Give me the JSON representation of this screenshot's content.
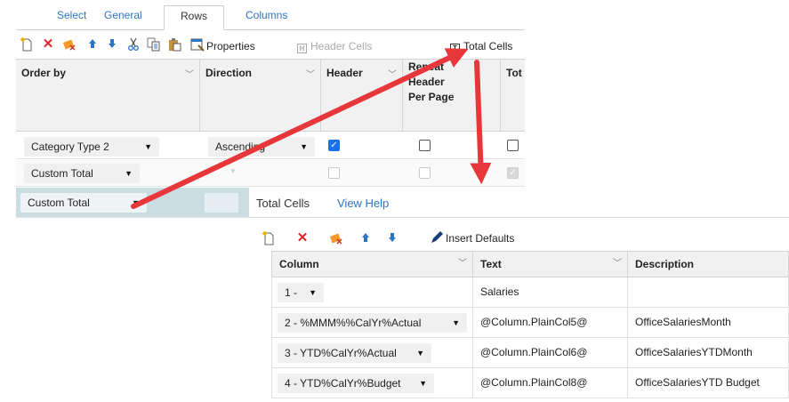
{
  "tabs": [
    {
      "label": "Select"
    },
    {
      "label": "General"
    },
    {
      "label": "Rows"
    },
    {
      "label": "Columns"
    }
  ],
  "toolbar": {
    "properties": "Properties",
    "header_cells": "Header Cells",
    "total_cells": "Total Cells",
    "header_cells_glyph": "H",
    "total_cells_glyph": "T"
  },
  "rows_grid": {
    "columns": [
      "Order by",
      "Direction",
      "Header",
      "Repeat Header Per Page",
      "Tot"
    ],
    "rows": [
      {
        "order_by": "Category Type 2",
        "direction": "Ascending"
      },
      {
        "order_by": "Custom Total",
        "direction": ""
      },
      {
        "order_by": "Custom Total",
        "direction": ""
      }
    ]
  },
  "overlay": {
    "title": "Total Cells",
    "help": "View Help",
    "insert_defaults": "Insert Defaults",
    "columns": [
      "Column",
      "Text",
      "Description"
    ],
    "rows": [
      {
        "column": "1 -",
        "text": "Salaries",
        "description": ""
      },
      {
        "column": "2 - %MMM%%CalYr%Actual",
        "text": "@Column.PlainCol5@",
        "description": "OfficeSalariesMonth"
      },
      {
        "column": "3 - YTD%CalYr%Actual",
        "text": "@Column.PlainCol6@",
        "description": "OfficeSalariesYTDMonth"
      },
      {
        "column": "4 - YTD%CalYr%Budget",
        "text": "@Column.PlainCol8@",
        "description": "OfficeSalariesYTD Budget"
      }
    ]
  },
  "colors": {
    "link": "#2d74c4",
    "checkbox": "#1a73e8",
    "annotation_arrow": "#e8373a",
    "selected_row": "#c9dde3"
  }
}
